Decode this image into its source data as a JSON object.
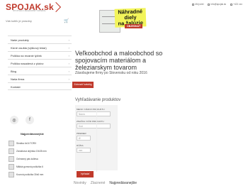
{
  "header": {
    "logo": "SPOJAK.sk",
    "logo_tagline": "SPOJOVACÍ A ŽELEZIARSKY MATERIÁL",
    "banner_text": "Náhradné diely\nna žalúzie",
    "banner_button": "OBJEDNAŤ",
    "top_links": [
      "Môj účet",
      "info@spojak.sk",
      "+421 xxx"
    ],
    "search_placeholder": "Váš kotlík je prázdny"
  },
  "sidebar": {
    "items": [
      {
        "label": "Naše produkty",
        "chev": "›"
      },
      {
        "label": "Klzné osušta (výškový lekár)",
        "chev": "›"
      },
      {
        "label": "Polička na rezanie lyžiek",
        "chev": "›"
      },
      {
        "label": "Polička nasadená z plotov",
        "chev": "›"
      },
      {
        "label": "Blog",
        "chev": "›"
      },
      {
        "label": "Naša firma",
        "chev": "›"
      },
      {
        "label": "Kontakt",
        "chev": ""
      }
    ],
    "social": [
      {
        "icon": "instagram-icon",
        "glyph": "◎"
      },
      {
        "icon": "facebook-icon",
        "glyph": "f"
      }
    ],
    "popular_title": "Najpredávanejšie",
    "popular_items": [
      "Skrutka 4x16 TORX",
      "Zárušková objímka 19x35 mm",
      "Ochranný pás koliesa",
      "Mäkká gumová podložka 6",
      "Kovová podložka 30x6 mm"
    ]
  },
  "main": {
    "headline": "Veľkoobchod a maloobchod so spojovacím materiálom a železiarskym tovarom",
    "subline": "Zásobujeme firmy po Slovensku od roku 2016",
    "contact_button": "Zobraziť katalóg",
    "search_title": "Vyhľadávanie produktov",
    "filter": {
      "label1": "MENO / NÁZOV PRODUKTU",
      "input1": "Názov",
      "label2": "ZNAČKA / KÓD PRODUKTU",
      "input2": "Kód",
      "label3": "PRIEMER",
      "input3": "Ø",
      "label4": "DĹŽKA",
      "input4": "mm",
      "search_button": "Vyhľadať produkty"
    },
    "tabs": [
      "Novinky",
      "Zlacnené",
      "Najpredávanejšie"
    ]
  },
  "colors": {
    "accent": "#c0392b",
    "text": "#333333"
  }
}
